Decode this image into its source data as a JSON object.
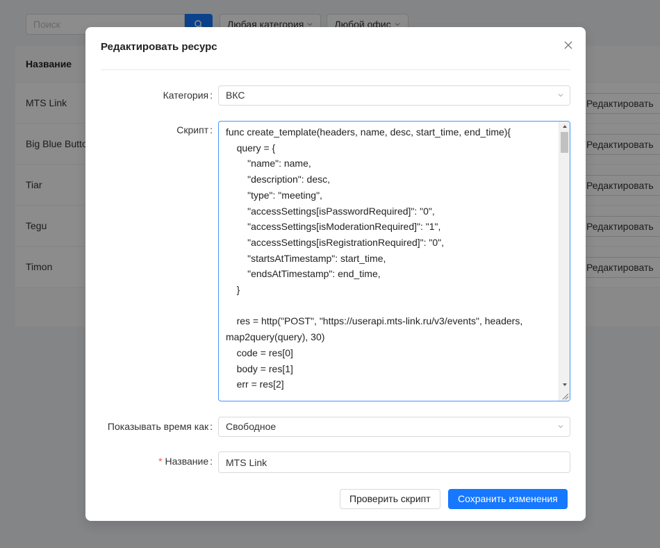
{
  "background": {
    "search_placeholder": "Поиск",
    "category_filter": "Любая категория",
    "office_filter": "Любой офис",
    "table_header": "Название",
    "rows": [
      "MTS Link",
      "Big Blue Button",
      "Tiar",
      "Tegu",
      "Timon"
    ],
    "edit_label": "Редактировать"
  },
  "modal": {
    "title": "Редактировать ресурс",
    "category_label": "Категория",
    "category_value": "ВКС",
    "script_label": "Скрипт",
    "script_value": "func create_template(headers, name, desc, start_time, end_time){\n    query = {\n        \"name\": name,\n        \"description\": desc,\n        \"type\": \"meeting\",\n        \"accessSettings[isPasswordRequired]\": \"0\",\n        \"accessSettings[isModerationRequired]\": \"1\",\n        \"accessSettings[isRegistrationRequired]\": \"0\",\n        \"startsAtTimestamp\": start_time,\n        \"endsAtTimestamp\": end_time,\n    }\n\n    res = http(\"POST\", \"https://userapi.mts-link.ru/v3/events\", headers, map2query(query), 30)\n    code = res[0]\n    body = res[1]\n    err = res[2]",
    "time_label": "Показывать время как",
    "time_value": "Свободное",
    "name_label": "Название",
    "name_value": "MTS Link",
    "check_button": "Проверить скрипт",
    "save_button": "Сохранить изменения"
  },
  "colors": {
    "primary": "#1677ff",
    "required": "#ff4d4f",
    "overlay": "rgba(0,0,0,0.45)"
  }
}
